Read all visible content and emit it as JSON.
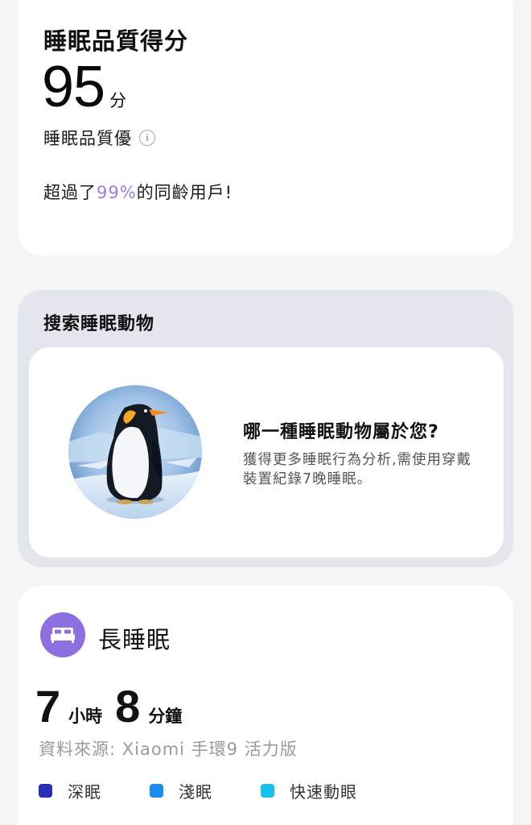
{
  "score_card": {
    "title": "睡眠品質得分",
    "score": "95",
    "score_unit": "分",
    "quality": "睡眠品質優",
    "percentile_prefix": "超過了",
    "percentile_value": "99%",
    "percentile_suffix": "的同齡用戶!"
  },
  "animal_card": {
    "title": "搜索睡眠動物",
    "question": "哪一種睡眠動物屬於您?",
    "description": "獲得更多睡眠行為分析,需使用穿戴裝置紀錄7晚睡眠。"
  },
  "long_sleep": {
    "title": "長睡眠",
    "hours": "7",
    "hours_unit": "小時",
    "minutes": "8",
    "minutes_unit": "分鐘",
    "source": "資料來源: Xiaomi 手環9 活力版",
    "legend": [
      {
        "label": "深眠",
        "color": "#2a2fb8"
      },
      {
        "label": "淺眠",
        "color": "#1e8cf0"
      },
      {
        "label": "快速動眼",
        "color": "#14c0ee"
      }
    ]
  },
  "colors": {
    "accent_purple": "#9b7be0",
    "bed_icon_bg": "#8d6fe0"
  }
}
